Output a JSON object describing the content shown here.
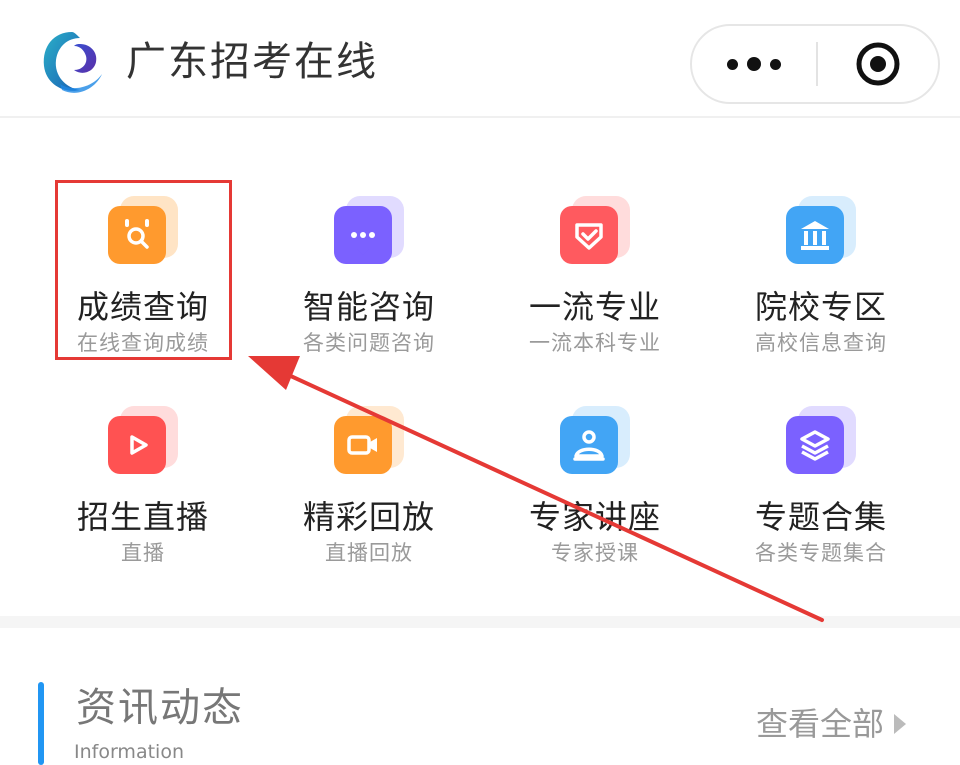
{
  "header": {
    "app_title": "广东招考在线",
    "logo_icon": "swirl-logo-icon",
    "more_icon": "more-dots-icon",
    "close_icon": "target-circle-icon"
  },
  "menu": [
    {
      "title": "成绩查询",
      "sub": "在线查询成绩",
      "icon": "search-calendar-icon",
      "color": "#ff9a2e"
    },
    {
      "title": "智能咨询",
      "sub": "各类问题咨询",
      "icon": "chat-bubble-icon",
      "color": "#7b61ff"
    },
    {
      "title": "一流专业",
      "sub": "一流本科专业",
      "icon": "badge-check-icon",
      "color": "#ff5a5f"
    },
    {
      "title": "院校专区",
      "sub": "高校信息查询",
      "icon": "building-icon",
      "color": "#42a5f5"
    },
    {
      "title": "招生直播",
      "sub": "直播",
      "icon": "play-icon",
      "color": "#ff5252"
    },
    {
      "title": "精彩回放",
      "sub": "直播回放",
      "icon": "video-camera-icon",
      "color": "#ff9a2e"
    },
    {
      "title": "专家讲座",
      "sub": "专家授课",
      "icon": "expert-user-icon",
      "color": "#42a5f5"
    },
    {
      "title": "专题合集",
      "sub": "各类专题集合",
      "icon": "layers-icon",
      "color": "#7b61ff"
    }
  ],
  "news": {
    "title": "资讯动态",
    "subtitle": "Information",
    "more_label": "查看全部",
    "accent": "#2196f3"
  },
  "annotation": {
    "box_color": "#e53935",
    "arrow_color": "#e53935"
  }
}
